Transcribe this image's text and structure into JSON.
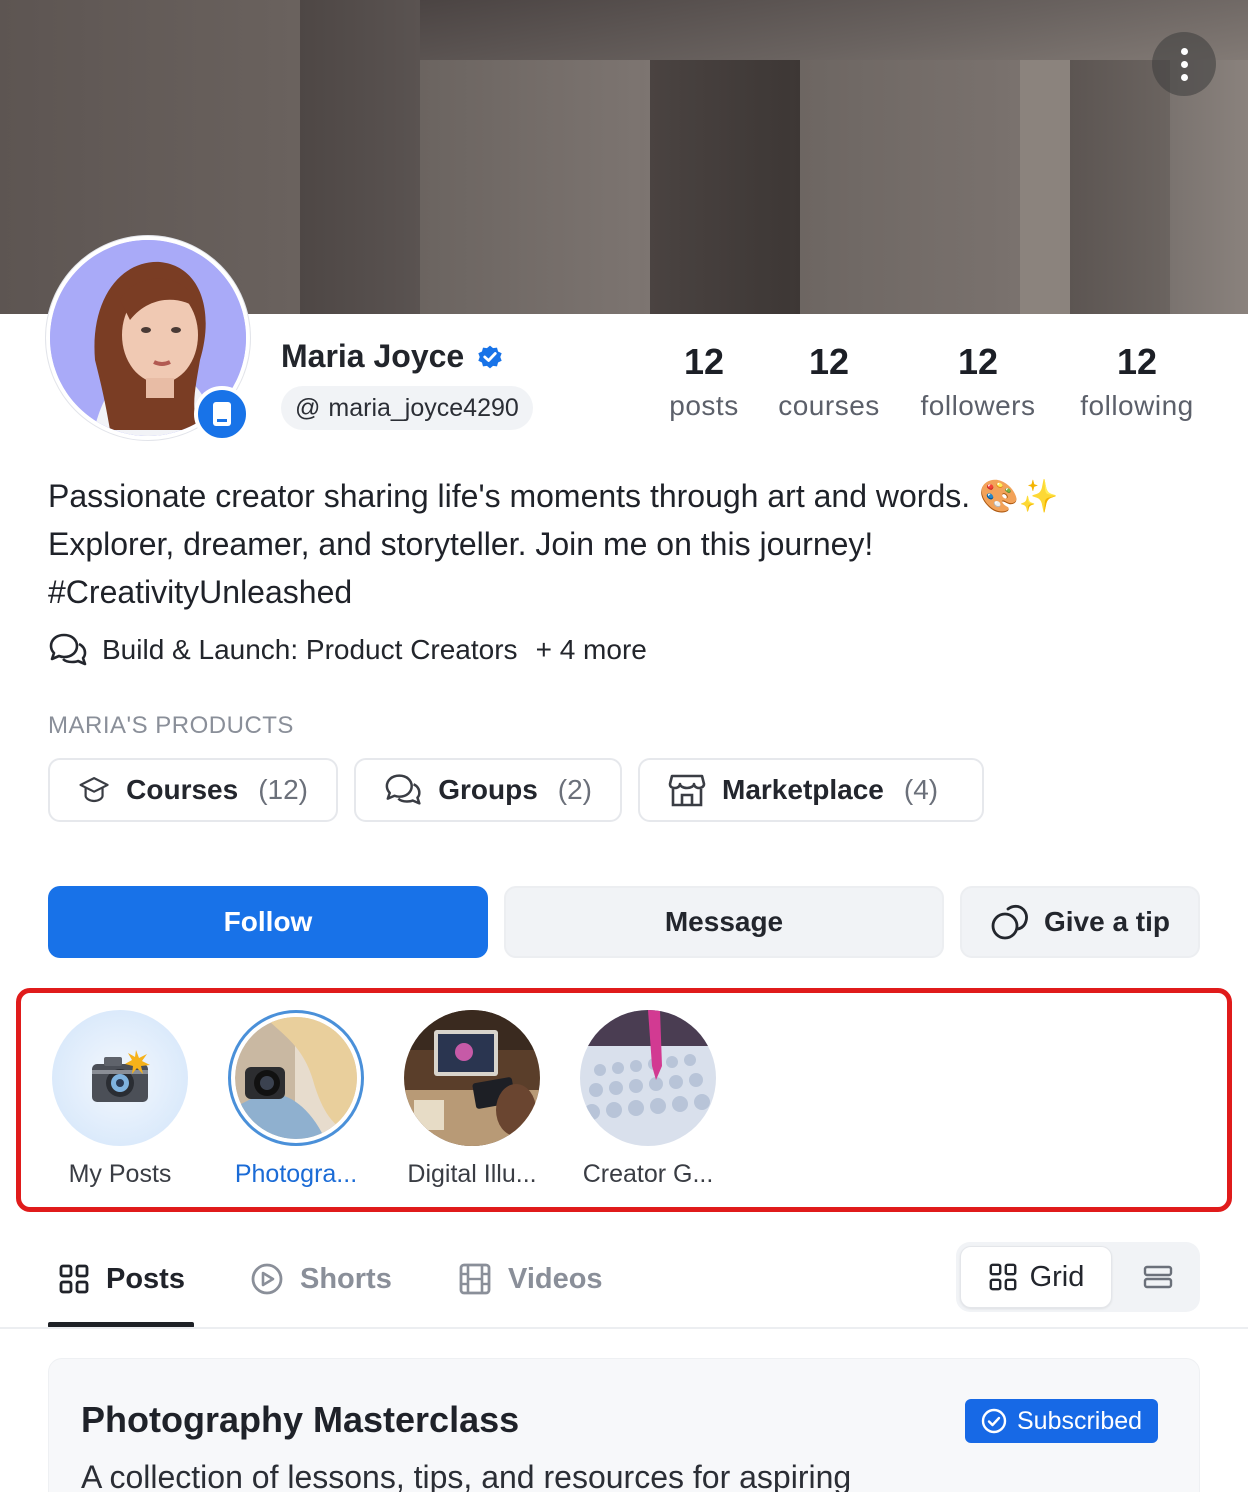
{
  "profile": {
    "name": "Maria Joyce",
    "handle": "maria_joyce4290",
    "handle_prefix": "@",
    "bio_line1": "Passionate creator sharing life's moments through art and words. 🎨✨",
    "bio_line2": "Explorer, dreamer, and storyteller. Join me on this journey!",
    "bio_line3": "#CreativityUnleashed",
    "community": "Build & Launch: Product Creators",
    "community_more": "+ 4 more"
  },
  "stats": [
    {
      "value": "12",
      "label": "posts"
    },
    {
      "value": "12",
      "label": "courses"
    },
    {
      "value": "12",
      "label": "followers"
    },
    {
      "value": "12",
      "label": "following"
    }
  ],
  "products": {
    "label": "MARIA'S PRODUCTS",
    "items": [
      {
        "name": "Courses",
        "count": "(12)",
        "icon": "graduation-cap-icon"
      },
      {
        "name": "Groups",
        "count": "(2)",
        "icon": "chat-bubbles-icon"
      },
      {
        "name": "Marketplace",
        "count": "(4)",
        "icon": "storefront-icon"
      }
    ]
  },
  "actions": {
    "follow": "Follow",
    "message": "Message",
    "tip": "Give a tip"
  },
  "stories": [
    {
      "label": "My Posts"
    },
    {
      "label": "Photogra..."
    },
    {
      "label": "Digital Illu..."
    },
    {
      "label": "Creator G..."
    }
  ],
  "tabs": [
    {
      "label": "Posts",
      "icon": "grid-icon"
    },
    {
      "label": "Shorts",
      "icon": "play-circle-icon"
    },
    {
      "label": "Videos",
      "icon": "film-icon"
    }
  ],
  "view": {
    "grid": "Grid"
  },
  "card": {
    "title": "Photography Masterclass",
    "badge": "Subscribed",
    "description": "A collection of lessons, tips, and resources for aspiring"
  },
  "colors": {
    "accent": "#1872e8",
    "highlight_border": "#e01b1b"
  }
}
